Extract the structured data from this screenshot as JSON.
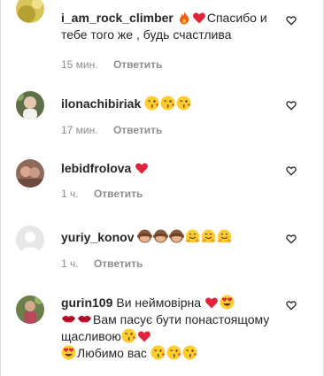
{
  "comments": [
    {
      "username": "i_am_rock_climber",
      "text_after_emoji": "Спасибо и тебе того же , будь счастлива",
      "time": "15 мин.",
      "reply_label": "Ответить",
      "emojis": [
        "fire",
        "red-heart"
      ]
    },
    {
      "username": "ilonachibiriak",
      "text_after_emoji": "",
      "time": "17 мин.",
      "reply_label": "Ответить",
      "emojis": [
        "kissing-face",
        "kissing-face",
        "kissing-face"
      ]
    },
    {
      "username": "lebidfrolova",
      "text_after_emoji": "",
      "time": "1 ч.",
      "reply_label": "Ответить",
      "emojis": [
        "red-heart"
      ]
    },
    {
      "username": "yuriy_konov",
      "text_after_emoji": "",
      "time": "1 ч.",
      "reply_label": "Ответить",
      "emojis": [
        "see-no-evil-monkey",
        "see-no-evil-monkey",
        "see-no-evil-monkey",
        "hugging-face",
        "hugging-face",
        "hugging-face"
      ]
    },
    {
      "username": "gurin109",
      "text_part1": "Ви неймовірна",
      "text_part2": "Вам пасує бути понастоящому щасливою",
      "text_part3": "Любимо вас",
      "emojis": [
        "red-heart",
        "heart-eyes-face",
        "kiss-lips",
        "kiss-lips",
        "kissing-face",
        "red-heart",
        "heart-eyes-face",
        "kissing-face",
        "kissing-face",
        "kissing-face"
      ]
    }
  ]
}
